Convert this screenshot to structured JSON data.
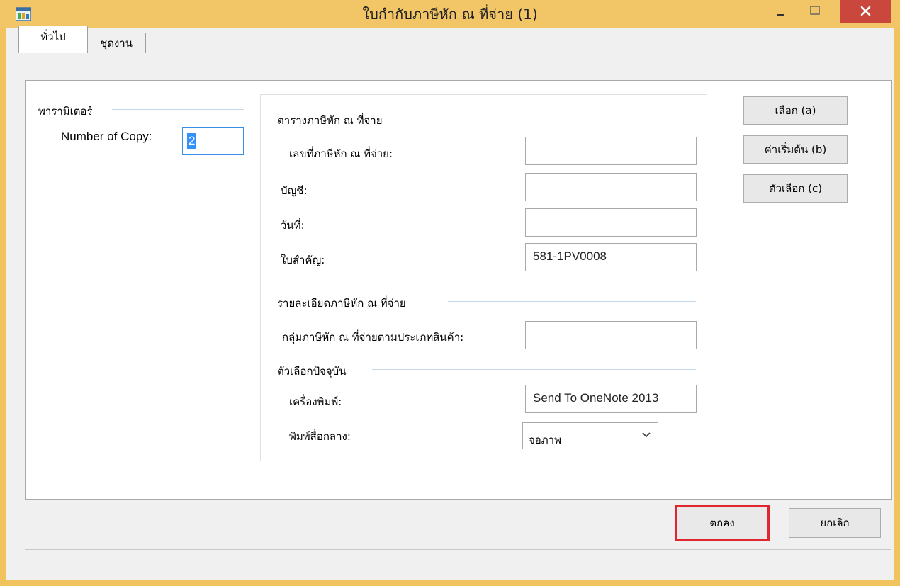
{
  "window": {
    "title": "ใบกำกับภาษีหัก ณ ที่จ่าย (1)",
    "icon": "app-report-icon",
    "accent_color": "#f2c567",
    "close_color": "#c9473c"
  },
  "tabs": [
    {
      "label": "ทั่วไป",
      "selected": true
    },
    {
      "label": "ชุดงาน",
      "selected": false
    }
  ],
  "parameters": {
    "group_title": "พารามิเตอร์",
    "copies_label": "Number of Copy:",
    "copies_value": "2"
  },
  "withholding_table": {
    "group_title": "ตารางภาษีหัก ณ ที่จ่าย",
    "fields": [
      {
        "label": "เลขที่ภาษีหัก ณ ที่จ่าย:",
        "value": ""
      },
      {
        "label": "บัญชี:",
        "value": ""
      },
      {
        "label": "วันที่:",
        "value": ""
      },
      {
        "label": "ใบสำคัญ:",
        "value": "581-1PV0008"
      }
    ]
  },
  "withholding_detail": {
    "group_title": "รายละเอียดภาษีหัก ณ ที่จ่าย",
    "fields": [
      {
        "label": "กลุ่มภาษีหัก ณ ที่จ่ายตามประเภทสินค้า:",
        "value": ""
      }
    ]
  },
  "current_options": {
    "group_title": "ตัวเลือกปัจจุบัน",
    "printer_label": "เครื่องพิมพ์:",
    "printer_value": "Send To OneNote 2013",
    "medium_label": "พิมพ์สื่อกลาง:",
    "medium_value": "จอภาพ"
  },
  "side_buttons": {
    "select": "เลือก (a)",
    "defaults": "ค่าเริ่มต้น (b)",
    "options": "ตัวเลือก (c)"
  },
  "footer_buttons": {
    "ok": "ตกลง",
    "cancel": "ยกเลิก",
    "ok_highlight_color": "#e0262e"
  }
}
